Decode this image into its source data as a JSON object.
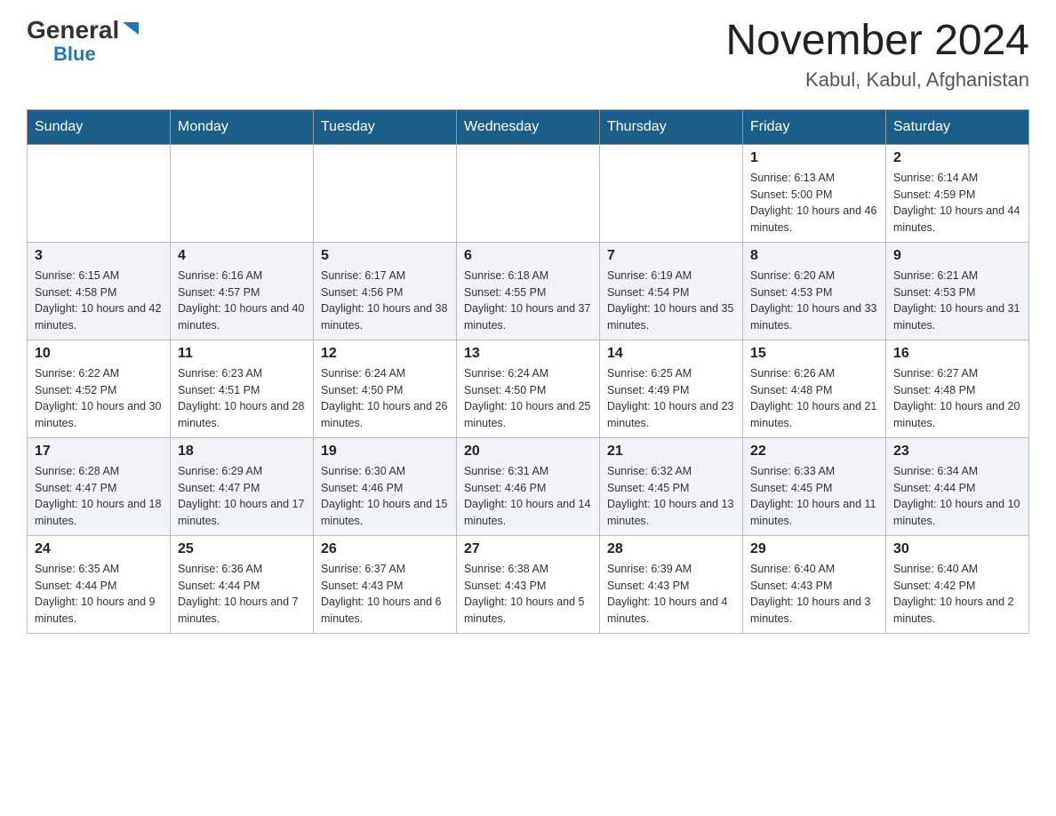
{
  "logo": {
    "general": "General",
    "blue": "Blue",
    "triangle": "▶"
  },
  "title": "November 2024",
  "location": "Kabul, Kabul, Afghanistan",
  "days_of_week": [
    "Sunday",
    "Monday",
    "Tuesday",
    "Wednesday",
    "Thursday",
    "Friday",
    "Saturday"
  ],
  "weeks": [
    [
      {
        "day": "",
        "info": ""
      },
      {
        "day": "",
        "info": ""
      },
      {
        "day": "",
        "info": ""
      },
      {
        "day": "",
        "info": ""
      },
      {
        "day": "",
        "info": ""
      },
      {
        "day": "1",
        "info": "Sunrise: 6:13 AM\nSunset: 5:00 PM\nDaylight: 10 hours and 46 minutes."
      },
      {
        "day": "2",
        "info": "Sunrise: 6:14 AM\nSunset: 4:59 PM\nDaylight: 10 hours and 44 minutes."
      }
    ],
    [
      {
        "day": "3",
        "info": "Sunrise: 6:15 AM\nSunset: 4:58 PM\nDaylight: 10 hours and 42 minutes."
      },
      {
        "day": "4",
        "info": "Sunrise: 6:16 AM\nSunset: 4:57 PM\nDaylight: 10 hours and 40 minutes."
      },
      {
        "day": "5",
        "info": "Sunrise: 6:17 AM\nSunset: 4:56 PM\nDaylight: 10 hours and 38 minutes."
      },
      {
        "day": "6",
        "info": "Sunrise: 6:18 AM\nSunset: 4:55 PM\nDaylight: 10 hours and 37 minutes."
      },
      {
        "day": "7",
        "info": "Sunrise: 6:19 AM\nSunset: 4:54 PM\nDaylight: 10 hours and 35 minutes."
      },
      {
        "day": "8",
        "info": "Sunrise: 6:20 AM\nSunset: 4:53 PM\nDaylight: 10 hours and 33 minutes."
      },
      {
        "day": "9",
        "info": "Sunrise: 6:21 AM\nSunset: 4:53 PM\nDaylight: 10 hours and 31 minutes."
      }
    ],
    [
      {
        "day": "10",
        "info": "Sunrise: 6:22 AM\nSunset: 4:52 PM\nDaylight: 10 hours and 30 minutes."
      },
      {
        "day": "11",
        "info": "Sunrise: 6:23 AM\nSunset: 4:51 PM\nDaylight: 10 hours and 28 minutes."
      },
      {
        "day": "12",
        "info": "Sunrise: 6:24 AM\nSunset: 4:50 PM\nDaylight: 10 hours and 26 minutes."
      },
      {
        "day": "13",
        "info": "Sunrise: 6:24 AM\nSunset: 4:50 PM\nDaylight: 10 hours and 25 minutes."
      },
      {
        "day": "14",
        "info": "Sunrise: 6:25 AM\nSunset: 4:49 PM\nDaylight: 10 hours and 23 minutes."
      },
      {
        "day": "15",
        "info": "Sunrise: 6:26 AM\nSunset: 4:48 PM\nDaylight: 10 hours and 21 minutes."
      },
      {
        "day": "16",
        "info": "Sunrise: 6:27 AM\nSunset: 4:48 PM\nDaylight: 10 hours and 20 minutes."
      }
    ],
    [
      {
        "day": "17",
        "info": "Sunrise: 6:28 AM\nSunset: 4:47 PM\nDaylight: 10 hours and 18 minutes."
      },
      {
        "day": "18",
        "info": "Sunrise: 6:29 AM\nSunset: 4:47 PM\nDaylight: 10 hours and 17 minutes."
      },
      {
        "day": "19",
        "info": "Sunrise: 6:30 AM\nSunset: 4:46 PM\nDaylight: 10 hours and 15 minutes."
      },
      {
        "day": "20",
        "info": "Sunrise: 6:31 AM\nSunset: 4:46 PM\nDaylight: 10 hours and 14 minutes."
      },
      {
        "day": "21",
        "info": "Sunrise: 6:32 AM\nSunset: 4:45 PM\nDaylight: 10 hours and 13 minutes."
      },
      {
        "day": "22",
        "info": "Sunrise: 6:33 AM\nSunset: 4:45 PM\nDaylight: 10 hours and 11 minutes."
      },
      {
        "day": "23",
        "info": "Sunrise: 6:34 AM\nSunset: 4:44 PM\nDaylight: 10 hours and 10 minutes."
      }
    ],
    [
      {
        "day": "24",
        "info": "Sunrise: 6:35 AM\nSunset: 4:44 PM\nDaylight: 10 hours and 9 minutes."
      },
      {
        "day": "25",
        "info": "Sunrise: 6:36 AM\nSunset: 4:44 PM\nDaylight: 10 hours and 7 minutes."
      },
      {
        "day": "26",
        "info": "Sunrise: 6:37 AM\nSunset: 4:43 PM\nDaylight: 10 hours and 6 minutes."
      },
      {
        "day": "27",
        "info": "Sunrise: 6:38 AM\nSunset: 4:43 PM\nDaylight: 10 hours and 5 minutes."
      },
      {
        "day": "28",
        "info": "Sunrise: 6:39 AM\nSunset: 4:43 PM\nDaylight: 10 hours and 4 minutes."
      },
      {
        "day": "29",
        "info": "Sunrise: 6:40 AM\nSunset: 4:43 PM\nDaylight: 10 hours and 3 minutes."
      },
      {
        "day": "30",
        "info": "Sunrise: 6:40 AM\nSunset: 4:42 PM\nDaylight: 10 hours and 2 minutes."
      }
    ]
  ]
}
